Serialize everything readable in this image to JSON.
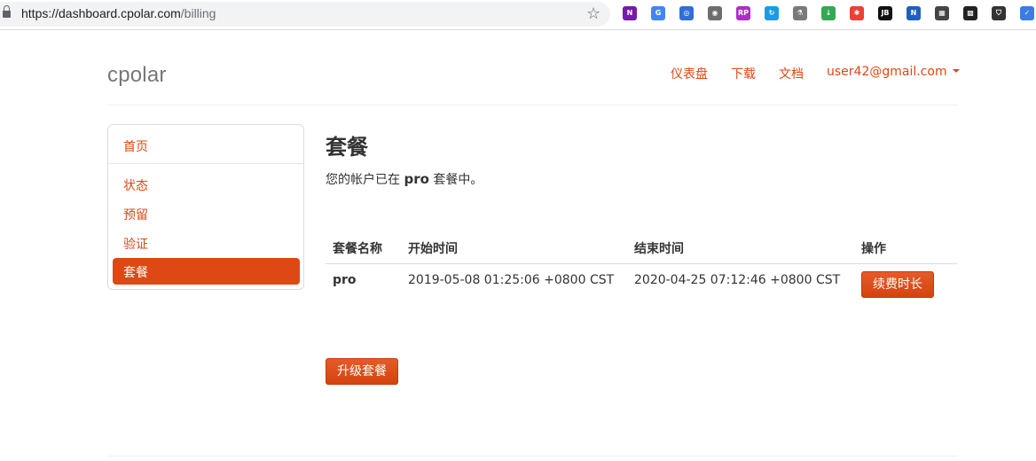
{
  "browser": {
    "url_scheme_host": "https://dashboard.cpolar.com",
    "url_path": "/billing",
    "extensions": [
      {
        "name": "onenote-icon",
        "color": "#7719aa",
        "label": "N"
      },
      {
        "name": "translate-icon",
        "color": "#4285f4",
        "label": "G"
      },
      {
        "name": "globe-extension-icon",
        "color": "#2f6fd6",
        "label": "◎"
      },
      {
        "name": "incognito-icon",
        "color": "#6d6d6d",
        "label": "◉"
      },
      {
        "name": "rp-icon",
        "color": "#b02cc9",
        "label": "RP"
      },
      {
        "name": "refresh-extension-icon",
        "color": "#1a9ce3",
        "label": "↻"
      },
      {
        "name": "microscope-icon",
        "color": "#7a7a7a",
        "label": "⚗"
      },
      {
        "name": "download-extension-icon",
        "color": "#34a853",
        "label": "↓"
      },
      {
        "name": "asterisk-extension-icon",
        "color": "#e94235",
        "label": "✱"
      },
      {
        "name": "jetbrains-icon",
        "color": "#111111",
        "label": "JB"
      },
      {
        "name": "n-extension-icon",
        "color": "#1f5fbf",
        "label": "N"
      },
      {
        "name": "qr-code-icon",
        "color": "#444444",
        "label": "▦"
      },
      {
        "name": "qr-code-alt-icon",
        "color": "#222222",
        "label": "▩"
      },
      {
        "name": "shield-extension-icon",
        "color": "#333333",
        "label": "⛉"
      },
      {
        "name": "check-circle-icon",
        "color": "#3b7de0",
        "label": "✓"
      }
    ]
  },
  "header": {
    "brand": "cpolar",
    "nav": {
      "dashboard": "仪表盘",
      "download": "下载",
      "docs": "文档",
      "account": "user42@gmail.com"
    }
  },
  "sidebar": {
    "home": "首页",
    "items": [
      "状态",
      "预留",
      "验证"
    ],
    "active": "套餐"
  },
  "main": {
    "title": "套餐",
    "desc_before": "您的帐户已在 ",
    "desc_plan": "pro",
    "desc_after": " 套餐中。",
    "table": {
      "headers": [
        "套餐名称",
        "开始时间",
        "结束时间",
        "操作"
      ],
      "row": {
        "plan": "pro",
        "start": "2019-05-08 01:25:06 +0800 CST",
        "end": "2020-04-25 07:12:46 +0800 CST",
        "action": "续费时长"
      }
    },
    "upgrade_button": "升级套餐"
  },
  "colors": {
    "accent": "#dd4814",
    "brand_text": "#777777"
  }
}
